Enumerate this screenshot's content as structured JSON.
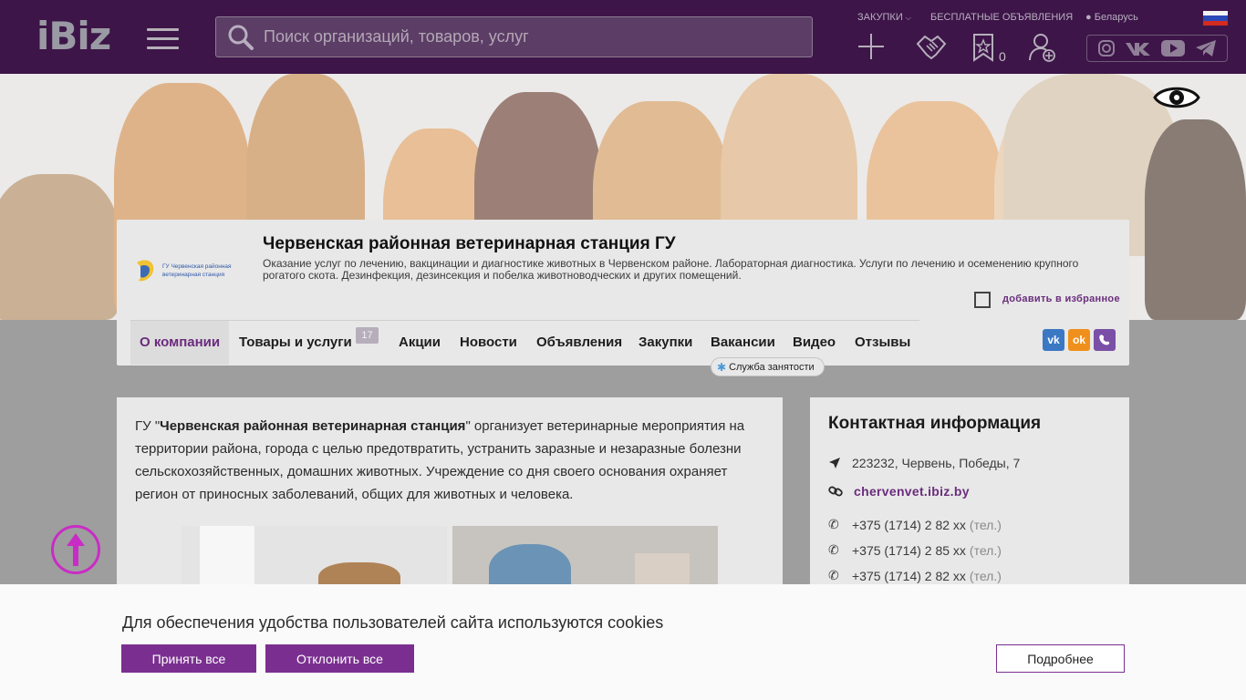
{
  "header": {
    "logo": "iBiz",
    "search_placeholder": "Поиск организаций, товаров, услуг",
    "links": {
      "purchases": "ЗАКУПКИ",
      "free_ads": "БЕСПЛАТНЫЕ ОБЪЯВЛЕНИЯ",
      "region": "Беларусь"
    },
    "favorites_count": "0",
    "icons": [
      "plus-icon",
      "handshake-icon",
      "star-bookmark-icon",
      "add-user-icon"
    ],
    "social_icons": [
      "instagram-icon",
      "vk-icon",
      "youtube-icon",
      "telegram-icon"
    ]
  },
  "company": {
    "logo_text": "ГУ Червенская районная ветеринарная станция",
    "title": "Червенская районная ветеринарная станция ГУ",
    "description": "Оказание услуг по лечению, вакцинации и диагностике животных в Червенском районе. Лабораторная диагностика. Услуги по лечению и осеменению крупного рогатого скота. Дезинфекция, дезинсекция и побелка животноводческих и других помещений.",
    "favorite_label": "добавить в избранное"
  },
  "tabs": {
    "about": "О компании",
    "goods": "Товары и услуги",
    "goods_count": "17",
    "promos": "Акции",
    "news": "Новости",
    "ads": "Объявления",
    "purchases": "Закупки",
    "vacancies": "Вакансии",
    "video": "Видео",
    "reviews": "Отзывы",
    "employment_service": "Служба занятости"
  },
  "main": {
    "prefix": "ГУ \"",
    "name_bold": "Червенская районная ветеринарная станция",
    "body": "\" организует ветеринарные мероприятия на территории района, города с целью предотвратить, устранить заразные и незаразные болезни сельскохозяйственных, домашних животных. Учреждение со дня своего основания охраняет регион от приносных заболеваний, общих для животных и человека."
  },
  "contacts": {
    "title": "Контактная информация",
    "address": "223232, Червень, Победы, 7",
    "site": "chervenvet.ibiz.by",
    "phones": [
      {
        "number": "+375 (1714) 2 82 xx",
        "type": "(тел.)"
      },
      {
        "number": "+375 (1714) 2 85 xx",
        "type": "(тел.)"
      },
      {
        "number": "+375 (1714) 2 82 xx",
        "type": "(тел.)"
      }
    ]
  },
  "cookie": {
    "text": "Для обеспечения удобства пользователей сайта используются cookies",
    "accept": "Принять все",
    "reject": "Отклонить все",
    "more": "Подробнее"
  },
  "colors": {
    "header_bg": "#3d1548",
    "accent": "#7a2f90",
    "link": "#6a2d7d",
    "up_button": "#c92cc5"
  }
}
